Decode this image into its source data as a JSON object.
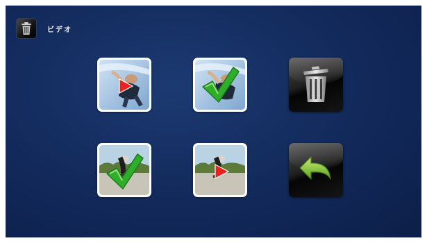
{
  "header": {
    "title": "ビデオ",
    "icon": "trash-can-icon"
  },
  "tiles": [
    {
      "name": "video-thumbnail-trick-play",
      "icon": "play-icon",
      "accent": "#e8231f"
    },
    {
      "name": "video-thumbnail-trick-selected",
      "icon": "checkmark-icon",
      "accent": "#2eae2b"
    },
    {
      "name": "delete-button",
      "icon": "trash-can-icon"
    },
    {
      "name": "video-thumbnail-skate-selected",
      "icon": "checkmark-icon",
      "accent": "#2eae2b"
    },
    {
      "name": "video-thumbnail-skate-play",
      "icon": "play-icon",
      "accent": "#e8231f"
    },
    {
      "name": "back-button",
      "icon": "return-arrow-icon",
      "accent": "#8cc63f"
    }
  ],
  "colors": {
    "background": "#12295a",
    "tile_dark": "#111111",
    "header_text": "#f2f2f2"
  }
}
